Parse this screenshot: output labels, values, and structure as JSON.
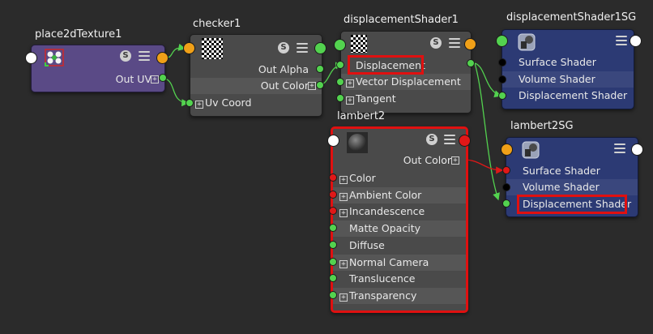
{
  "nodes": {
    "place2d": {
      "title": "place2dTexture1",
      "out_uv": "Out UV"
    },
    "checker": {
      "title": "checker1",
      "out_alpha": "Out Alpha",
      "out_color": "Out Color",
      "uv_coord": "Uv Coord"
    },
    "disp_shader": {
      "title": "displacementShader1",
      "displacement": "Displacement",
      "vector_displacement": "Vector Displacement",
      "tangent": "Tangent"
    },
    "disp_sg": {
      "title": "displacementShader1SG",
      "surface": "Surface Shader",
      "volume": "Volume Shader",
      "displacement": "Displacement Shader"
    },
    "lambert2": {
      "title": "lambert2",
      "out_color": "Out Color",
      "attrs": [
        "Color",
        "Ambient Color",
        "Incandescence",
        "Matte Opacity",
        "Diffuse",
        "Normal Camera",
        "Translucence",
        "Transparency"
      ]
    },
    "lambert_sg": {
      "title": "lambert2SG",
      "surface": "Surface Shader",
      "volume": "Volume Shader",
      "displacement": "Displacement Shader"
    }
  },
  "icons": {
    "s_button": "S",
    "plus": "+"
  },
  "colors": {
    "background": "#2b2b2b",
    "node_gray": "#4a4a4a",
    "node_purple": "#5a4a86",
    "node_blue": "#2c3a74",
    "port_green": "#53d24f",
    "port_red": "#e01818",
    "port_orange": "#f0a018",
    "highlight_red": "#e01010"
  }
}
